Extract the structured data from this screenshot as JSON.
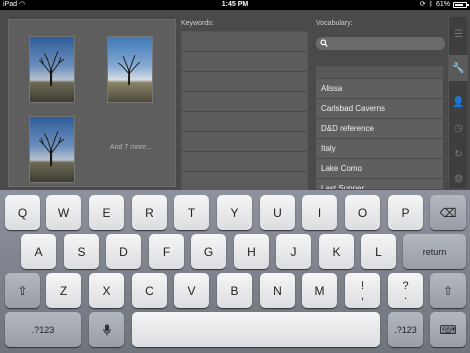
{
  "status_bar": {
    "device": "iPad",
    "time": "1:45 PM",
    "battery": "61%"
  },
  "thumbnails": {
    "more_text": "And 7 more..."
  },
  "keywords": {
    "label": "Keywords:"
  },
  "vocabulary": {
    "label": "Vocabulary:",
    "search_placeholder": "",
    "items": [
      "Alissa",
      "Carlsbad Caverns",
      "D&D reference",
      "Italy",
      "Lake Como",
      "Last Supper"
    ]
  },
  "tools": [
    "menu-icon",
    "wrench-icon",
    "person-icon",
    "clock-icon",
    "sync-icon",
    "globe-icon"
  ],
  "keyboard": {
    "row1": [
      "Q",
      "W",
      "E",
      "R",
      "T",
      "Y",
      "U",
      "I",
      "O",
      "P"
    ],
    "row2": [
      "A",
      "S",
      "D",
      "F",
      "G",
      "H",
      "J",
      "K",
      "L"
    ],
    "row3": [
      "Z",
      "X",
      "C",
      "V",
      "B",
      "N",
      "M"
    ],
    "return": "return",
    "numbers": ".?123",
    "shift": "⇧",
    "backspace": "⌫",
    "dismiss": "⌨",
    "mic": "🎤",
    "punct1": [
      "!",
      ","
    ],
    "punct2": [
      "?",
      "."
    ]
  }
}
